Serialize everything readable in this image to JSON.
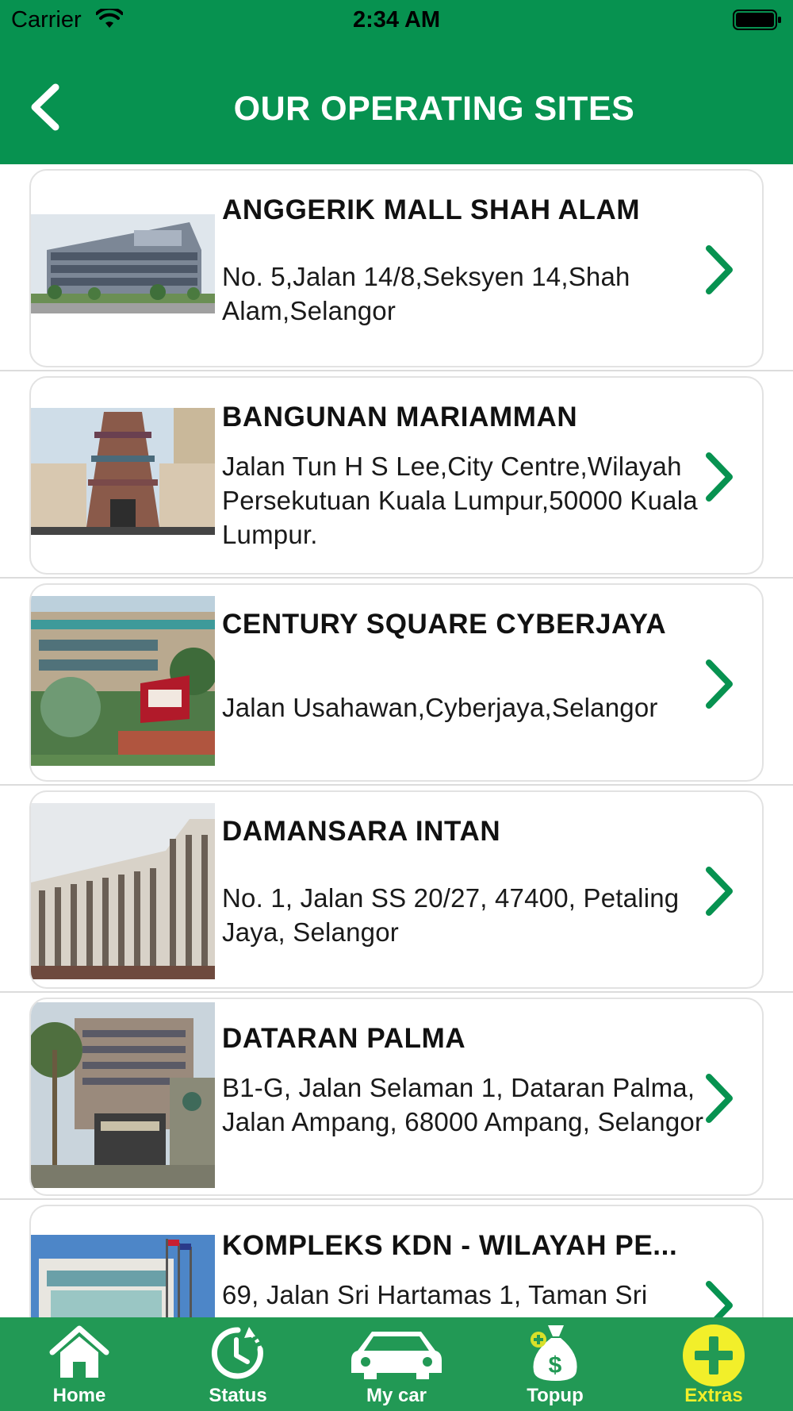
{
  "status_bar": {
    "carrier": "Carrier",
    "time": "2:34 AM"
  },
  "header": {
    "title": "OUR OPERATING SITES"
  },
  "sites": [
    {
      "name": "ANGGERIK MALL SHAH ALAM",
      "address": "No. 5,Jalan 14/8,Seksyen 14,Shah Alam,Selangor"
    },
    {
      "name": "BANGUNAN MARIAMMAN",
      "address": "Jalan Tun H S Lee,City Centre,Wilayah Persekutuan Kuala Lumpur,50000  Kuala Lumpur."
    },
    {
      "name": "CENTURY SQUARE CYBERJAYA",
      "address": "Jalan Usahawan,Cyberjaya,Selangor"
    },
    {
      "name": "DAMANSARA INTAN",
      "address": "No. 1, Jalan SS 20/27, 47400, Petaling Jaya, Selangor"
    },
    {
      "name": "DATARAN PALMA",
      "address": "B1-G, Jalan Selaman 1, Dataran Palma, Jalan Ampang, 68000 Ampang, Selangor"
    },
    {
      "name": "KOMPLEKS KDN - WILAYAH PE...",
      "address": "69, Jalan Sri Hartamas 1, Taman Sri"
    }
  ],
  "tabs": [
    {
      "label": "Home",
      "icon": "home-icon"
    },
    {
      "label": "Status",
      "icon": "status-clock-icon"
    },
    {
      "label": "My car",
      "icon": "car-icon"
    },
    {
      "label": "Topup",
      "icon": "money-bag-icon"
    },
    {
      "label": "Extras",
      "icon": "plus-circle-icon"
    }
  ],
  "active_tab": "Extras",
  "colors": {
    "primary_green": "#079250",
    "tab_bar_green": "#229955",
    "active_tab": "#f2ef2a"
  }
}
